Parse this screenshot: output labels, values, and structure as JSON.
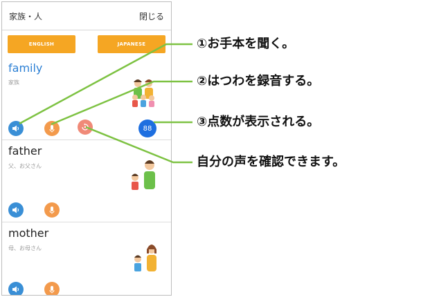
{
  "header": {
    "title": "家族・人",
    "close_label": "閉じる"
  },
  "language_buttons": {
    "english": "ENGLISH",
    "japanese": "JAPANESE"
  },
  "entries": [
    {
      "word": "family",
      "reading": "家族",
      "score": "88"
    },
    {
      "word": "father",
      "reading": "父、お父さん"
    },
    {
      "word": "mother",
      "reading": "母、お母さん"
    }
  ],
  "callouts": {
    "listen": "①お手本を聞く。",
    "record": "②はつわを録音する。",
    "score": "③点数が表示される。",
    "playback": "自分の声を確認できます。"
  },
  "icons": {
    "listen": "speaker-icon",
    "record": "microphone-icon",
    "playback": "replay-icon"
  },
  "colors": {
    "accent_orange": "#f5a623",
    "listen_button": "#3a8fd6",
    "record_button": "#f39a4c",
    "playback_button": "#f08a78",
    "score_badge": "#1e6fe0",
    "callout_line": "#7dc242",
    "word_highlight": "#2b7fd4"
  }
}
